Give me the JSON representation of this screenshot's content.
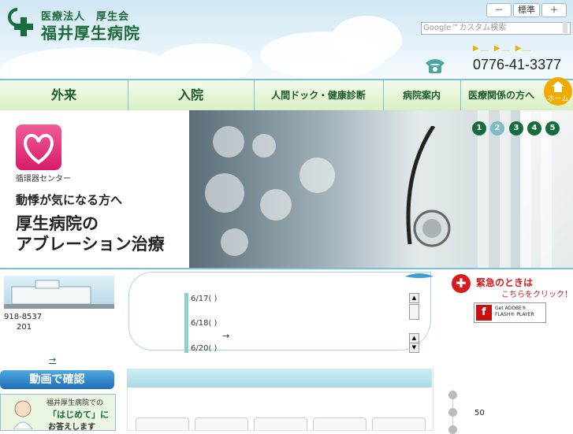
{
  "header": {
    "logo_sub": "医療法人　厚生会",
    "logo_main": "福井厚生病院",
    "font_size_buttons": [
      "－",
      "標準",
      "＋"
    ],
    "search_placeholder": "Google™カスタム検索",
    "phone": "0776-41-3377"
  },
  "nav": {
    "items": [
      "外来",
      "入院",
      "人間ドック・健康診断",
      "病院案内",
      "医療関係の方へ"
    ],
    "home_label": "ホーム"
  },
  "hero": {
    "caption": "循環器センター",
    "line1": "動悸が気になる方へ",
    "line2": "厚生病院の",
    "line3": "アブレーション治療",
    "slides": [
      "1",
      "2",
      "3",
      "4",
      "5"
    ],
    "active_slide": 2
  },
  "left": {
    "address_line1": "918-8537",
    "address_line2": "201",
    "map_link": "→",
    "video_button": "動画で確認",
    "hajime_line1": "福井厚生病院での",
    "hajime_line2": "「はじめて」に",
    "hajime_line3": "お答えします"
  },
  "news": {
    "dates": [
      "6/17( )",
      "6/18( )",
      "6/20( )"
    ],
    "arrow": "→"
  },
  "right": {
    "emergency_title": "緊急のときは",
    "emergency_sub": "こちらをクリック！",
    "flash_line1": "Get ADOBE®",
    "flash_line2": "FLASH® PLAYER",
    "number": "50"
  },
  "colors": {
    "brand_green": "#156c3c",
    "nav_border": "#7bc0d8",
    "emergency_red": "#d81b1b",
    "home_orange": "#f2a900"
  }
}
